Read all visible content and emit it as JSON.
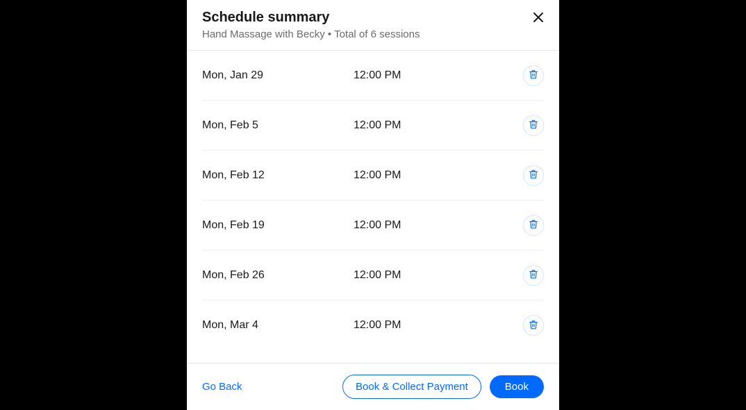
{
  "header": {
    "title": "Schedule summary",
    "subtitle": "Hand Massage with Becky • Total of 6 sessions"
  },
  "sessions": [
    {
      "date": "Mon, Jan 29",
      "time": "12:00 PM"
    },
    {
      "date": "Mon, Feb 5",
      "time": "12:00 PM"
    },
    {
      "date": "Mon, Feb 12",
      "time": "12:00 PM"
    },
    {
      "date": "Mon, Feb 19",
      "time": "12:00 PM"
    },
    {
      "date": "Mon, Feb 26",
      "time": "12:00 PM"
    },
    {
      "date": "Mon, Mar 4",
      "time": "12:00 PM"
    }
  ],
  "footer": {
    "go_back": "Go Back",
    "book_collect": "Book & Collect Payment",
    "book": "Book"
  },
  "colors": {
    "accent": "#006aff"
  }
}
